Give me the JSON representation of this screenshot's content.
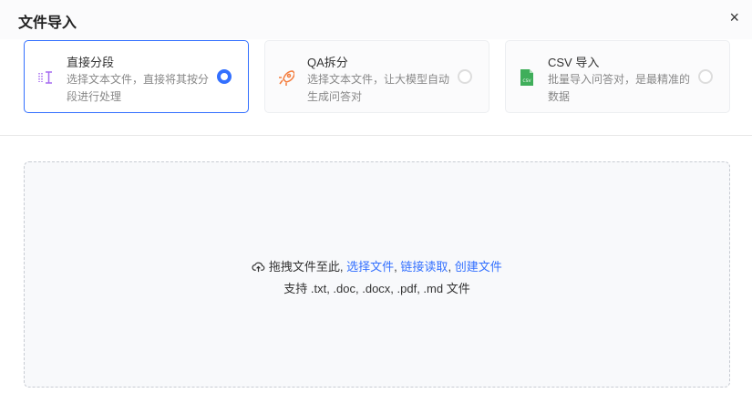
{
  "dialog": {
    "title": "文件导入",
    "close": "×"
  },
  "options": [
    {
      "name": "直接分段",
      "desc": "选择文本文件，直接将其按分段进行处理",
      "selected": true,
      "icon": "text-split-icon"
    },
    {
      "name": "QA拆分",
      "desc": "选择文本文件，让大模型自动生成问答对",
      "selected": false,
      "icon": "rocket-icon"
    },
    {
      "name": "CSV 导入",
      "desc": "批量导入问答对，是最精准的数据",
      "selected": false,
      "icon": "csv-file-icon"
    }
  ],
  "upload": {
    "prefix": "拖拽文件至此,",
    "link1": "选择文件",
    "sep1": ",",
    "link2": "链接读取",
    "sep2": ",",
    "link3": "创建文件",
    "hint": "支持 .txt, .doc, .docx, .pdf, .md 文件"
  },
  "colors": {
    "accent": "#3370ff"
  }
}
